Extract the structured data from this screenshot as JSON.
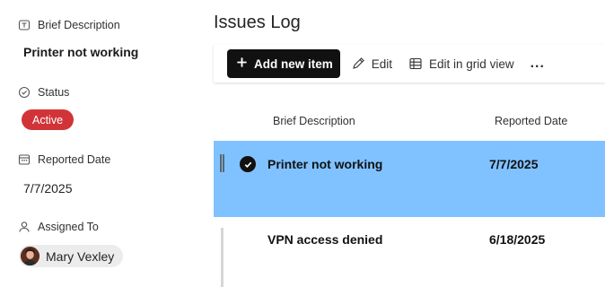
{
  "details": {
    "brief_description_label": "Brief Description",
    "brief_description_value": "Printer not working",
    "status_label": "Status",
    "status_value": "Active",
    "reported_date_label": "Reported Date",
    "reported_date_value": "7/7/2025",
    "assigned_to_label": "Assigned To",
    "assigned_to_value": "Mary Vexley",
    "status_color": "#d13438"
  },
  "list": {
    "title": "Issues Log",
    "commands": {
      "add_new_item": "Add new item",
      "edit": "Edit",
      "edit_in_grid_view": "Edit in grid view",
      "more": "..."
    },
    "columns": [
      "Brief Description",
      "Reported Date"
    ],
    "rows": [
      {
        "brief_description": "Printer not working",
        "reported_date": "7/7/2025",
        "selected": true
      },
      {
        "brief_description": "VPN access denied",
        "reported_date": "6/18/2025",
        "selected": false
      }
    ],
    "selection_color": "#80c2ff"
  }
}
